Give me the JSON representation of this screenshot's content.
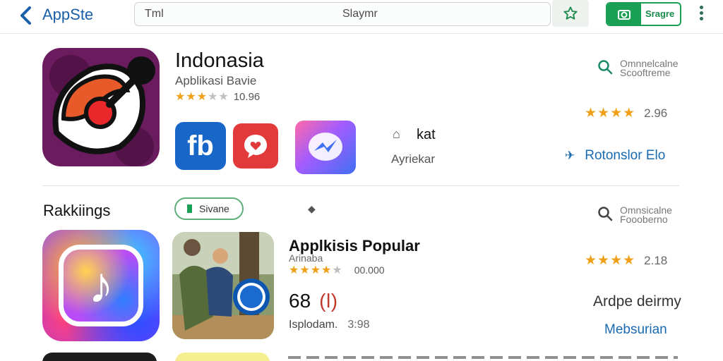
{
  "topbar": {
    "brand": "AppSte",
    "search_left": "Tml",
    "search_mid": "Slaymr",
    "save_label": "Sragre"
  },
  "featured": {
    "title": "Indonasia",
    "subtitle": "Apblikasi Bavie",
    "rating": "10.96",
    "stars_full": 3,
    "kat_label": "kat",
    "kat_sub": "Ayriekar",
    "side_text_1": "Omnnelcalne",
    "side_text_2": "Scooftreme",
    "side_rating": "2.96",
    "side_link": "Rotonslor Elo"
  },
  "ranking": {
    "title": "Rakkiings",
    "chip_label": "Sivane",
    "side_text_1": "Omnsicalne",
    "side_text_2": "Foooberno",
    "app_title": "Applkisis Popular",
    "app_sub": "Arinaba",
    "app_rating": "00.000",
    "count": "68",
    "count_symbol": "(ǀ)",
    "foot_label": "Isplodam.",
    "foot_value": "3:98",
    "side_rating": "2.18",
    "side_label": "Ardpe deirmy",
    "side_link": "Mebsurian"
  },
  "colors": {
    "accent_blue": "#1a5fa8",
    "accent_green": "#1aa054",
    "star": "#f0a018"
  },
  "icons": [
    "chevron-left-icon",
    "star-icon",
    "camera-icon",
    "kebab-icon",
    "search-icon",
    "pin-icon",
    "home-icon",
    "tag-icon"
  ]
}
